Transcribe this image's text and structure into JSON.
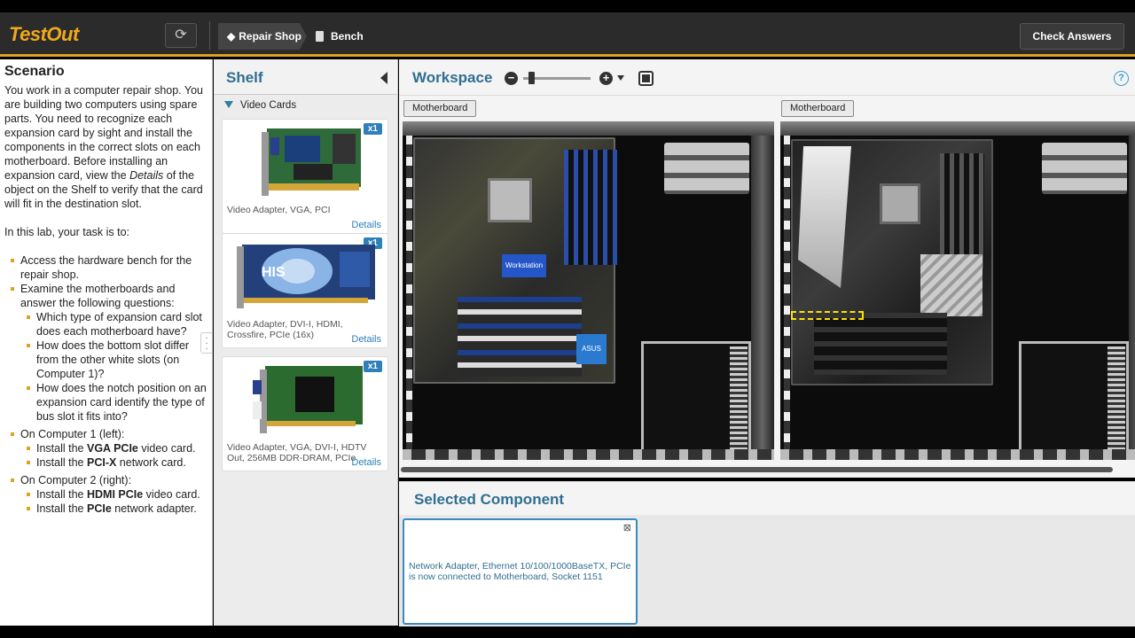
{
  "app": {
    "logo": "TestOut",
    "breadcrumb": [
      "Repair Shop",
      "Bench"
    ],
    "check_answers": "Check Answers"
  },
  "scenario": {
    "title": "Scenario",
    "intro_parts": [
      "You work in a computer repair shop. You are building two computers using spare parts. You need to recognize each expansion card by sight and install the components in the correct slots on each motherboard. Before installing an expansion card, view the ",
      "Details",
      " of the object on the Shelf to verify that the card will fit in the destination slot."
    ],
    "task_intro": "In this lab, your task is to:",
    "tasks": {
      "t1": "Access the hardware bench for the repair shop.",
      "t2": "Examine the motherboards and answer the following questions:",
      "q1": "Which type of expansion card slot does each motherboard have?",
      "q2": "How does the bottom slot differ from the other white slots (on Computer 1)?",
      "q3": "How does the notch position on an expansion card identify the type of bus slot it fits into?",
      "t3": "On Computer 1 (left):",
      "c1a_pre": "Install the ",
      "c1a_bold": "VGA PCIe",
      "c1a_post": " video card.",
      "c1b_pre": "Install the ",
      "c1b_bold": "PCI-X",
      "c1b_post": " network card.",
      "t4": "On Computer 2 (right):",
      "c2a_pre": "Install the ",
      "c2a_bold": "HDMI PCIe",
      "c2a_post": " video card.",
      "c2b_pre": "Install the ",
      "c2b_bold": "PCIe",
      "c2b_post": " network adapter."
    }
  },
  "shelf": {
    "title": "Shelf",
    "category": "Video Cards",
    "items": [
      {
        "qty": "x1",
        "name": "Video Adapter, VGA, PCI",
        "details": "Details"
      },
      {
        "qty": "x1",
        "name": "Video Adapter, DVI-I, HDMI, Crossfire, PCIe (16x)",
        "details": "Details"
      },
      {
        "qty": "x1",
        "name": "Video Adapter, VGA, DVI-I, HDTV Out, 256MB DDR-DRAM, PCIe",
        "details": "Details"
      }
    ]
  },
  "workspace": {
    "title": "Workspace",
    "zoom_level": 0.1,
    "computers": [
      {
        "label": "Motherboard",
        "board_chip": "Workstation",
        "board_logo": "ASUS"
      },
      {
        "label": "Motherboard"
      }
    ]
  },
  "selected_component": {
    "title": "Selected Component",
    "message": "Network Adapter, Ethernet 10/100/1000BaseTX, PCIe is now connected to Motherboard, Socket 1151"
  },
  "colors": {
    "accent": "#e0a020",
    "heading": "#2f6f91",
    "link": "#2f7fb8"
  }
}
